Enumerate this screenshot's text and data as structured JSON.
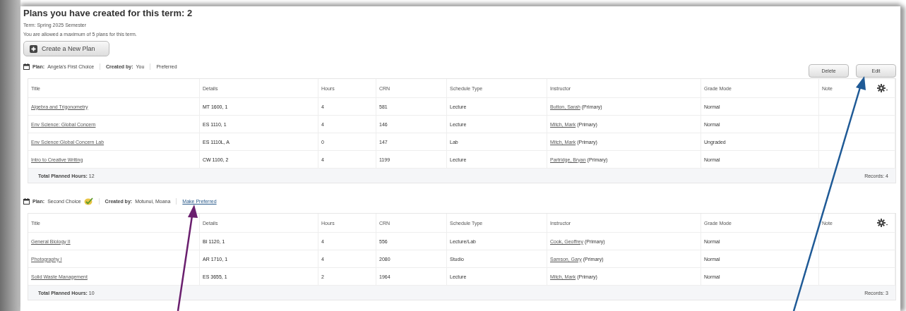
{
  "heading": "Plans you have created for this term: 2",
  "term": "Term: Spring 2025 Semester",
  "allowance": "You are allowed a maximum of 5 plans for this term.",
  "create_button": "Create a New Plan",
  "plans": [
    {
      "plan_label": "Plan:",
      "name": "Angela's First Choice",
      "check_badge": false,
      "created_label": "Created by:",
      "created_by": "You",
      "status": {
        "kind": "text",
        "text": "Preferred"
      },
      "actions": [
        "Delete",
        "Edit"
      ],
      "columns": [
        "Title",
        "Details",
        "Hours",
        "CRN",
        "Schedule Type",
        "Instructor",
        "Grade Mode",
        "Note"
      ],
      "rows": [
        {
          "title": "Algebra and Trigonometry",
          "details": "MT 1600, 1",
          "hours": "4",
          "crn": "581",
          "schedule_type": "Lecture",
          "instructor": "Button, Sarah",
          "role": "(Primary)",
          "grade_mode": "Normal"
        },
        {
          "title": "Env Science: Global Concern",
          "details": "ES 1110, 1",
          "hours": "4",
          "crn": "146",
          "schedule_type": "Lecture",
          "instructor": "Mitch, Mark",
          "role": "(Primary)",
          "grade_mode": "Normal"
        },
        {
          "title": "Env Science:Global Concern Lab",
          "details": "ES 1110L, A",
          "hours": "0",
          "crn": "147",
          "schedule_type": "Lab",
          "instructor": "Mitch, Mark",
          "role": "(Primary)",
          "grade_mode": "Ungraded"
        },
        {
          "title": "Intro to Creative Writing",
          "details": "CW 1100, 2",
          "hours": "4",
          "crn": "1199",
          "schedule_type": "Lecture",
          "instructor": "Partridge, Bryan",
          "role": "(Primary)",
          "grade_mode": "Normal"
        }
      ],
      "total_label": "Total Planned Hours:",
      "total": "12",
      "records": "Records: 4"
    },
    {
      "plan_label": "Plan:",
      "name": "Second Choice",
      "check_badge": true,
      "created_label": "Created by:",
      "created_by": "Motunui, Moana",
      "status": {
        "kind": "link",
        "text": "Make Preferred"
      },
      "columns": [
        "Title",
        "Details",
        "Hours",
        "CRN",
        "Schedule Type",
        "Instructor",
        "Grade Mode",
        "Note"
      ],
      "rows": [
        {
          "title": "General Biology II",
          "details": "BI 1120, 1",
          "hours": "4",
          "crn": "556",
          "schedule_type": "Lecture/Lab",
          "instructor": "Cook, Geoffrey",
          "role": "(Primary)",
          "grade_mode": "Normal"
        },
        {
          "title": "Photography I",
          "details": "AR 1710, 1",
          "hours": "4",
          "crn": "2080",
          "schedule_type": "Studio",
          "instructor": "Samson, Gary",
          "role": "(Primary)",
          "grade_mode": "Normal"
        },
        {
          "title": "Solid Waste Management",
          "details": "ES 3655, 1",
          "hours": "2",
          "crn": "1964",
          "schedule_type": "Lecture",
          "instructor": "Mitch, Mark",
          "role": "(Primary)",
          "grade_mode": "Normal"
        }
      ],
      "total_label": "Total Planned Hours:",
      "total": "10",
      "records": "Records: 3"
    }
  ]
}
